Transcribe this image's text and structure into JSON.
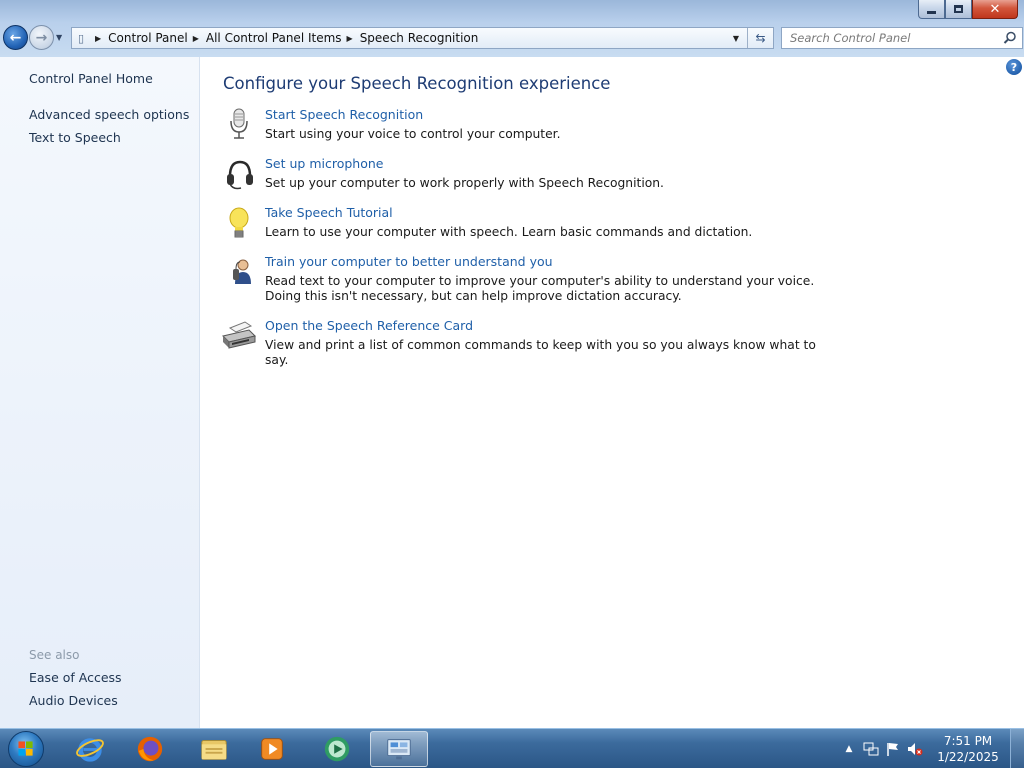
{
  "window": {
    "caption_buttons": {
      "minimize": "minimize-icon",
      "restore": "restore-icon",
      "close": "close-icon"
    }
  },
  "address_bar": {
    "breadcrumbs": [
      "Control Panel",
      "All Control Panel Items",
      "Speech Recognition"
    ]
  },
  "search": {
    "placeholder": "Search Control Panel"
  },
  "left_pane": {
    "home": "Control Panel Home",
    "links": [
      "Advanced speech options",
      "Text to Speech"
    ],
    "see_also_heading": "See also",
    "see_also": [
      "Ease of Access",
      "Audio Devices"
    ]
  },
  "main": {
    "title": "Configure your Speech Recognition experience",
    "tasks": [
      {
        "icon": "microphone-icon",
        "link": "Start Speech Recognition",
        "description": "Start using your voice to control your computer."
      },
      {
        "icon": "headset-icon",
        "link": "Set up microphone",
        "description": "Set up your computer to work properly with Speech Recognition."
      },
      {
        "icon": "lightbulb-icon",
        "link": "Take Speech Tutorial",
        "description": "Learn to use your computer with speech.  Learn basic commands and dictation."
      },
      {
        "icon": "user-training-icon",
        "link": "Train your computer to better understand you",
        "description": "Read text to your computer to improve your computer's ability to understand your voice.  Doing this isn't necessary, but can help improve dictation accuracy."
      },
      {
        "icon": "printer-icon",
        "link": "Open the Speech Reference Card",
        "description": "View and print a list of common commands to keep with you so you always know what to say."
      }
    ]
  },
  "taskbar": {
    "apps": [
      "internet-explorer-icon",
      "firefox-icon",
      "file-explorer-icon",
      "media-player-icon",
      "media-center-icon",
      "control-panel-icon"
    ],
    "clock": {
      "time": "7:51 PM",
      "date": "1/22/2025"
    }
  },
  "colors": {
    "link": "#1f5fa8",
    "title": "#1e3c74",
    "nav_text": "#1e3450",
    "see_also": "#8c9aaa"
  }
}
